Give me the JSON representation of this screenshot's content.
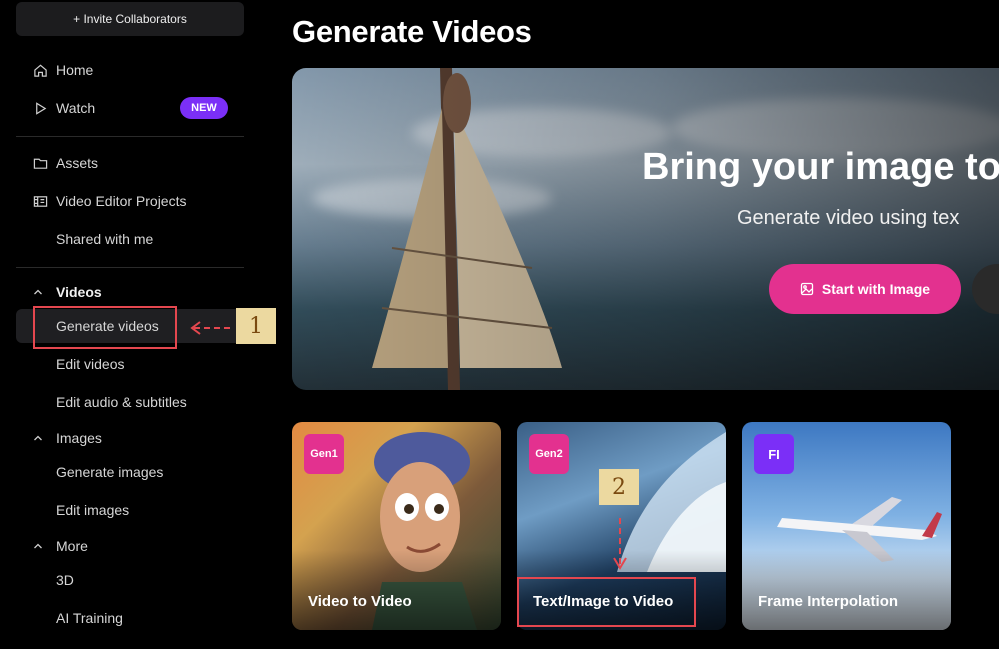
{
  "sidebar": {
    "invite_label": "+ Invite Collaborators",
    "home": "Home",
    "watch": "Watch",
    "watch_badge": "NEW",
    "assets": "Assets",
    "video_editor_projects": "Video Editor Projects",
    "shared_with_me": "Shared with me",
    "videos_section": "Videos",
    "generate_videos": "Generate videos",
    "edit_videos": "Edit videos",
    "edit_audio_subtitles": "Edit audio & subtitles",
    "images_section": "Images",
    "generate_images": "Generate images",
    "edit_images": "Edit images",
    "more_section": "More",
    "three_d": "3D",
    "ai_training": "AI Training"
  },
  "main": {
    "title": "Generate Videos",
    "hero": {
      "title": "Bring your image to",
      "subtitle": "Generate video using tex",
      "primary_button": "Start with Image"
    },
    "cards": [
      {
        "tag": "Gen1",
        "label": "Video to Video",
        "tag_color": "#e3318f"
      },
      {
        "tag": "Gen2",
        "label": "Text/Image to Video",
        "tag_color": "#e3318f"
      },
      {
        "tag": "FI",
        "label": "Frame Interpolation",
        "tag_color": "#7b2ff7"
      }
    ]
  },
  "annotations": {
    "marker_1": "1",
    "marker_2": "2",
    "highlight_color": "#e4474f"
  },
  "colors": {
    "accent_pink": "#e3318f",
    "accent_purple": "#7b2ff7"
  }
}
